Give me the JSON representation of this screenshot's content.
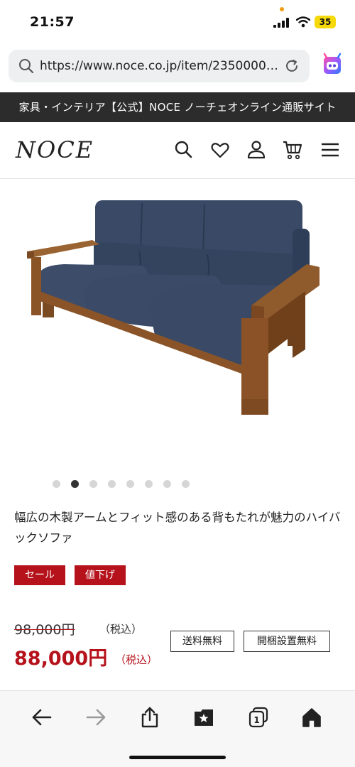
{
  "status_bar": {
    "time": "21:57",
    "battery": "35",
    "icons": [
      "signal-icon",
      "wifi-icon",
      "battery-icon"
    ]
  },
  "browser": {
    "url": "https://www.noce.co.jp/item/23500000...",
    "icons": [
      "search-icon",
      "reload-icon",
      "assistant-icon"
    ]
  },
  "site": {
    "banner": "家具・インテリア【公式】NOCE ノーチェオンライン通販サイト",
    "logo": "NOCE",
    "header_icons": [
      "search-icon",
      "heart-icon",
      "user-icon",
      "cart-icon",
      "menu-icon"
    ]
  },
  "product": {
    "image_alt": "sofa-image",
    "carousel": {
      "total": 8,
      "active_index": 1
    },
    "title": "幅広の木製アームとフィット感のある背もたれが魅力のハイバックソファ",
    "badges": [
      "セール",
      "値下げ"
    ],
    "old_price": "98,000円",
    "old_price_tax": "（税込）",
    "price": "88,000円",
    "price_tax": "（税込）",
    "service_tags": [
      "送料無料",
      "開梱設置無料"
    ]
  },
  "toolbar": {
    "icons": [
      "back-arrow-icon",
      "forward-arrow-icon",
      "share-icon",
      "bookmarks-icon",
      "tabs-icon",
      "home-icon"
    ],
    "tabs_count": "1"
  },
  "colors": {
    "accent_red": "#b5121b",
    "banner_dark": "#2c2c2c",
    "battery_yellow": "#f5d90a"
  }
}
